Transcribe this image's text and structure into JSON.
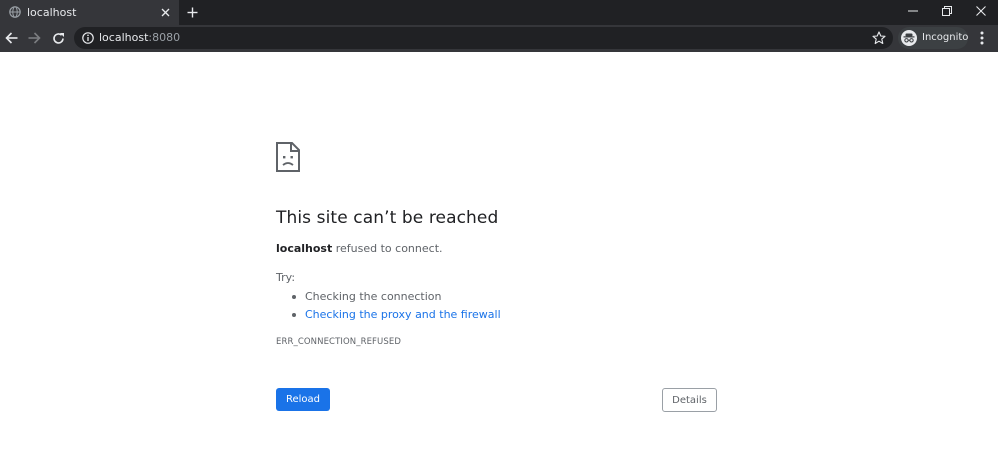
{
  "browser": {
    "tab": {
      "title": "localhost",
      "favicon": "globe-icon"
    },
    "omnibox": {
      "host": "localhost",
      "port": ":8080"
    },
    "profile": {
      "label": "Incognito",
      "icon": "incognito-icon"
    },
    "colors": {
      "frame": "#202124",
      "toolbar": "#35363a",
      "text": "#e8eaed"
    }
  },
  "page": {
    "icon": "sad-page-icon",
    "title": "This site can’t be reached",
    "description_host": "localhost",
    "description_rest": " refused to connect.",
    "try_label": "Try:",
    "suggestions": [
      "Checking the connection",
      "Checking the proxy and the firewall"
    ],
    "error_code": "ERR_CONNECTION_REFUSED",
    "reload_label": "Reload",
    "details_label": "Details",
    "colors": {
      "accent": "#1a73e8",
      "title": "#202124",
      "body": "#5f6368"
    }
  }
}
